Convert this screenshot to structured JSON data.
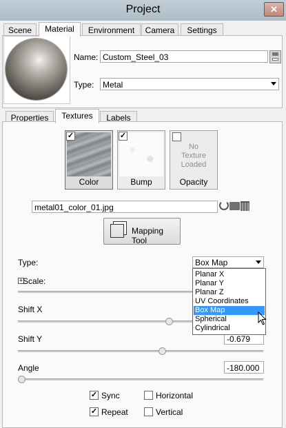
{
  "window": {
    "title": "Project",
    "close_label": "✕"
  },
  "top_tabs": [
    "Scene",
    "Material",
    "Environment",
    "Camera",
    "Settings"
  ],
  "material": {
    "name_label": "Name:",
    "name_value": "Custom_Steel_03",
    "type_label": "Type:",
    "type_value": "Metal"
  },
  "sub_tabs": [
    "Properties",
    "Textures",
    "Labels"
  ],
  "textures": {
    "slots": [
      {
        "label": "Color",
        "checked": true
      },
      {
        "label": "Bump",
        "checked": true
      },
      {
        "label": "Opacity",
        "checked": false,
        "empty_text": [
          "No",
          "Texture",
          "Loaded"
        ]
      }
    ],
    "file_name": "metal01_color_01.jpg",
    "mapping_tool_label": "Mapping Tool",
    "type_label": "Type:",
    "type_value": "Box Map",
    "type_options": [
      "Planar X",
      "Planar Y",
      "Planar Z",
      "UV Coordinates",
      "Box Map",
      "Spherical",
      "Cylindrical"
    ],
    "highlighted_option": "Box Map",
    "scale_label": "Scale:",
    "shift_x_label": "Shift X",
    "shift_x_position": 0.62,
    "shift_y_label": "Shift Y",
    "shift_y_value": "-0.679",
    "shift_y_position": 0.59,
    "angle_label": "Angle",
    "angle_value": "-180.000",
    "angle_position": 0.0,
    "options": [
      {
        "label": "Sync",
        "checked": true
      },
      {
        "label": "Horizontal",
        "checked": false
      },
      {
        "label": "Repeat",
        "checked": true
      },
      {
        "label": "Vertical",
        "checked": false
      }
    ]
  }
}
